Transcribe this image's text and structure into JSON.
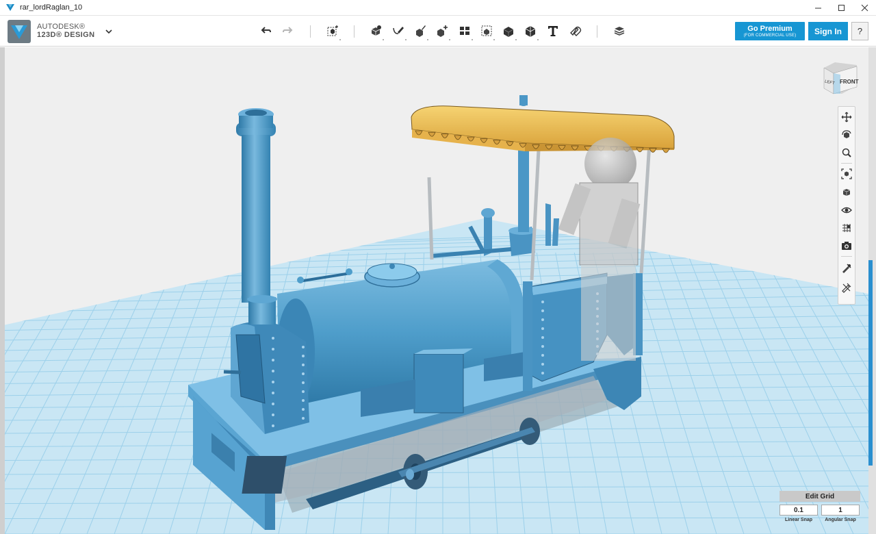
{
  "window": {
    "title": "rar_lordRaglan_10",
    "minimize_label": "—",
    "close_icon": "close-icon"
  },
  "brand": {
    "line1": "AUTODESK®",
    "line2": "123D® DESIGN"
  },
  "toolbar": {
    "tools": [
      "undo-icon",
      "redo-icon",
      "transform-icon",
      "primitives-icon",
      "sketch-icon",
      "construct-icon",
      "modify-icon",
      "pattern-icon",
      "group-icon",
      "combine-icon",
      "measure-icon",
      "text-icon",
      "snap-icon",
      "material-icon"
    ]
  },
  "actions": {
    "premium_label": "Go Premium",
    "premium_sub": "(FOR COMMERCIAL USE)",
    "signin_label": "Sign In",
    "help_label": "?"
  },
  "viewcube": {
    "left_label": "LEFT",
    "front_label": "FRONT"
  },
  "navbar": {
    "items": [
      "pan-icon",
      "orbit-icon",
      "zoom-icon",
      "fit-icon",
      "views-icon",
      "visibility-icon",
      "grid-toggle-icon",
      "camera-icon",
      "snap-icon-a",
      "snap-icon-b"
    ]
  },
  "grid_panel": {
    "edit_label": "Edit Grid",
    "linear_value": "0.1",
    "linear_label": "Linear Snap",
    "angular_value": "1",
    "angular_label": "Angular Snap"
  },
  "colors": {
    "accent": "#1796d3",
    "model_blue": "#4f9ecb",
    "canopy_yellow": "#e9b84f",
    "grid_line": "#9cd0ea"
  }
}
